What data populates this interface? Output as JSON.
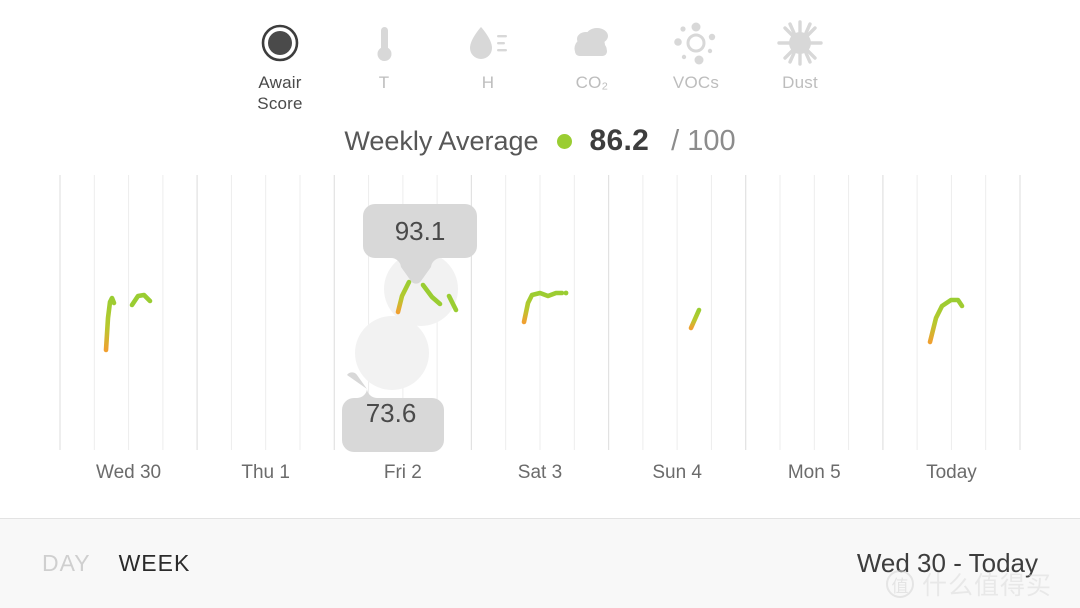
{
  "app": {
    "title": "Awair Air Quality Trends"
  },
  "metrics": [
    {
      "id": "awair-score",
      "label": "Awair\nScore",
      "icon": "awair-score-icon",
      "active": true
    },
    {
      "id": "temperature",
      "label": "T",
      "icon": "thermometer-icon",
      "active": false
    },
    {
      "id": "humidity",
      "label": "H",
      "icon": "droplet-icon",
      "active": false
    },
    {
      "id": "co2",
      "label": "CO₂",
      "icon": "cloud-icon",
      "active": false
    },
    {
      "id": "vocs",
      "label": "VOCs",
      "icon": "sun-dots-icon",
      "active": false
    },
    {
      "id": "dust",
      "label": "Dust",
      "icon": "dust-particle-icon",
      "active": false
    }
  ],
  "summary": {
    "title": "Weekly Average",
    "value": "86.2",
    "max": "/ 100",
    "dot_color": "#9acd32"
  },
  "colors": {
    "good": "#9acd32",
    "fair": "#f0a030",
    "grid": "#ebebeb",
    "grid_major": "#e0e0e0",
    "tooltip_bg": "#d8d8d8",
    "tooltip_text": "#4a4a4a",
    "halo": "#f2f2f2"
  },
  "chart_data": {
    "type": "line",
    "title": "Awair Score — Weekly trend",
    "xlabel": "",
    "ylabel": "Awair Score",
    "ylim": [
      0,
      100
    ],
    "grid": true,
    "legend": "none",
    "categories": [
      "Wed 30",
      "Thu 1",
      "Fri 2",
      "Sat 3",
      "Sun 4",
      "Mon 5",
      "Today"
    ],
    "annotations": [
      {
        "label": "93.1",
        "day": "Fri 2",
        "position": "above",
        "value": 93.1
      },
      {
        "label": "73.6",
        "day": "Fri 2",
        "position": "below",
        "value": 73.6
      }
    ],
    "series": [
      {
        "name": "Awair Score",
        "segments": [
          {
            "day": "Wed 30",
            "points": [
              [
                0.33,
                62
              ],
              [
                0.35,
                78
              ],
              [
                0.37,
                88
              ],
              [
                0.4,
                90
              ],
              [
                0.42,
                86
              ]
            ]
          },
          {
            "day": "Wed 30",
            "points": [
              [
                0.52,
                88
              ],
              [
                0.55,
                92
              ],
              [
                0.58,
                91
              ],
              [
                0.61,
                88
              ]
            ]
          },
          {
            "day": "Fri 2",
            "points": [
              [
                0.4,
                74
              ],
              [
                0.43,
                84
              ],
              [
                0.45,
                90
              ],
              [
                0.47,
                93
              ]
            ]
          },
          {
            "day": "Fri 2",
            "points": [
              [
                0.58,
                93
              ],
              [
                0.62,
                89
              ],
              [
                0.65,
                86
              ]
            ]
          },
          {
            "day": "Fri 2",
            "points": [
              [
                0.78,
                87
              ],
              [
                0.82,
                82
              ]
            ]
          },
          {
            "day": "Sat 3",
            "points": [
              [
                0.27,
                72
              ],
              [
                0.3,
                84
              ],
              [
                0.33,
                90
              ],
              [
                0.37,
                91
              ],
              [
                0.42,
                89
              ],
              [
                0.47,
                91
              ],
              [
                0.52,
                91
              ]
            ]
          },
          {
            "day": "Sat 3",
            "points": [
              [
                0.65,
                91
              ],
              [
                0.66,
                91
              ]
            ]
          },
          {
            "day": "Sun 4",
            "points": [
              [
                0.46,
                80
              ],
              [
                0.5,
                88
              ]
            ]
          },
          {
            "day": "Today",
            "points": [
              [
                0.25,
                72
              ],
              [
                0.29,
                84
              ],
              [
                0.33,
                90
              ],
              [
                0.38,
                92
              ],
              [
                0.44,
                92
              ],
              [
                0.48,
                90
              ]
            ]
          }
        ]
      }
    ]
  },
  "bottom": {
    "tabs": [
      {
        "id": "day",
        "label": "DAY",
        "active": false
      },
      {
        "id": "week",
        "label": "WEEK",
        "active": true
      }
    ],
    "date_range": "Wed 30 - Today"
  },
  "watermark": {
    "badge": "值",
    "text": "什么值得买"
  }
}
